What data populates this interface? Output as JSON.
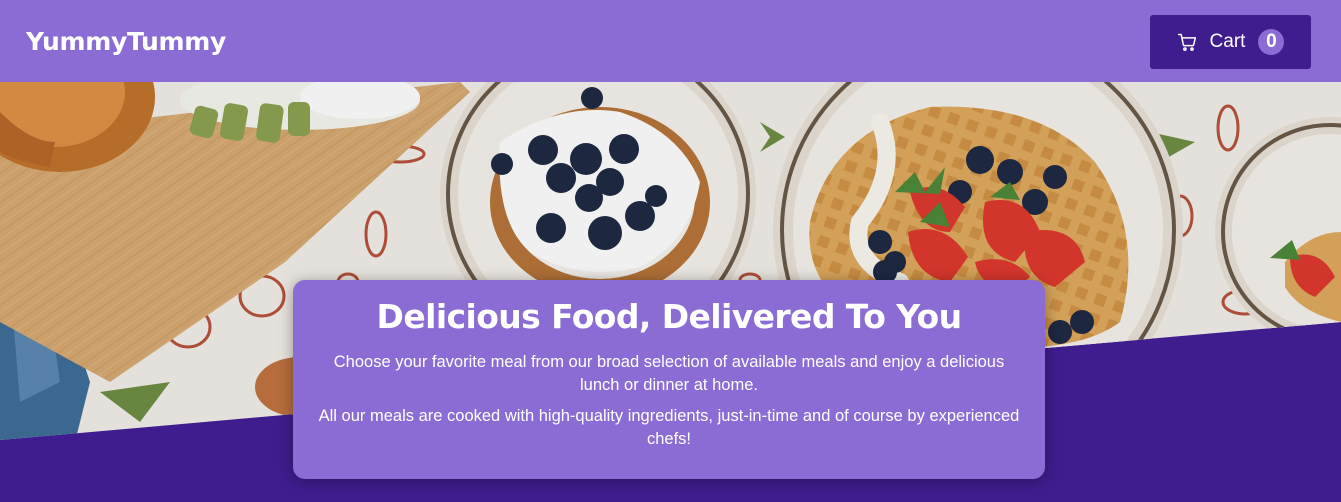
{
  "header": {
    "logo": "YummyTummy",
    "cart": {
      "label": "Cart",
      "count": "0",
      "icon": "cart-icon"
    }
  },
  "hero": {
    "image": "meals-table-photo"
  },
  "summary": {
    "title": "Delicious Food, Delivered To You",
    "paragraph1": "Choose your favorite meal from our broad selection of available meals and enjoy a delicious lunch or dinner at home.",
    "paragraph2": "All our meals are cooked with high-quality ingredients, just-in-time and of course by experienced chefs!"
  },
  "colors": {
    "header_bg": "#8a6cd4",
    "page_bg": "#3f1d8e",
    "button_bg": "#3f1d8e",
    "card_bg": "#8a6cd4"
  }
}
